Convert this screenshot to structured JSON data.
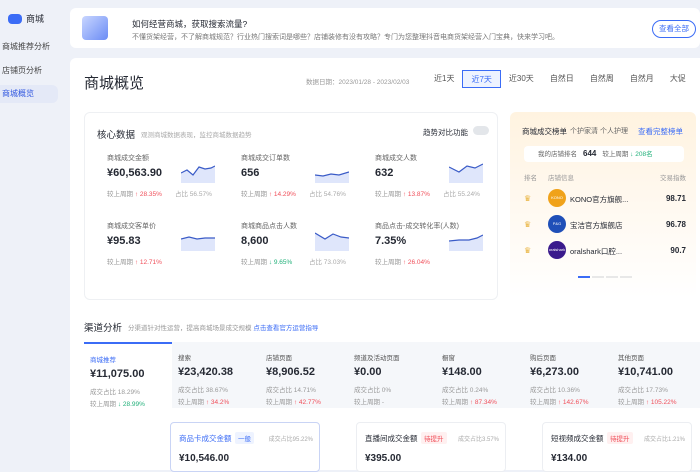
{
  "sidebar": {
    "brand": "商城",
    "items": [
      "商城推荐分析",
      "店铺页分析",
      "商城概览"
    ]
  },
  "banner": {
    "title": "如何经营商城，获取搜索流量?",
    "desc": "不懂货架经营，不了解商城规范？行业热门搜索词是哪些？店铺装修有没有攻略？专门为您整理抖音电商货架经营入门宝典，快来学习吧。",
    "button": "查看全部"
  },
  "header": {
    "title": "商城概览",
    "date": "数据日期：2023/01/28 - 2023/02/03",
    "ranges": [
      "近1天",
      "近7天",
      "近30天",
      "自然日",
      "自然周",
      "自然月",
      "大促"
    ]
  },
  "core": {
    "title": "核心数据",
    "subtitle": "观测商城数据表现，监控商城数据趋势",
    "trend_toggle": "趋势对比功能",
    "metrics": [
      {
        "label": "商城成交金额",
        "value": "¥60,563.90",
        "cmp_label": "较上周期",
        "change": "↑ 28.35%",
        "dir": "up",
        "share": "占比 56.57%"
      },
      {
        "label": "商城成交订单数",
        "value": "656",
        "cmp_label": "较上周期",
        "change": "↑ 14.29%",
        "dir": "up",
        "share": "占比 54.76%"
      },
      {
        "label": "商城成交人数",
        "value": "632",
        "cmp_label": "较上周期",
        "change": "↑ 13.87%",
        "dir": "up",
        "share": "占比 55.24%"
      },
      {
        "label": "商城成交客单价",
        "value": "¥95.83",
        "cmp_label": "较上周期",
        "change": "↑ 12.71%",
        "dir": "up",
        "share": ""
      },
      {
        "label": "商城商品点击人数",
        "value": "8,600",
        "cmp_label": "较上周期",
        "change": "↓ 9.65%",
        "dir": "down",
        "share": "占比 73.03%"
      },
      {
        "label": "商品点击-成交转化率(人数)",
        "value": "7.35%",
        "cmp_label": "较上周期",
        "change": "↑ 26.04%",
        "dir": "up",
        "share": ""
      }
    ]
  },
  "ranking": {
    "title": "商城成交榜单",
    "category": "个护家清 个人护理",
    "link": "查看完整榜单",
    "my_rank_label": "我的店铺排名",
    "my_rank": "644",
    "my_rank_cmp": "较上周期",
    "my_rank_change": "↓ 208名",
    "headers": [
      "排名",
      "店铺信息",
      "交易指数"
    ],
    "rows": [
      {
        "name": "KONO官方旗舰...",
        "score": "98.71",
        "logo": "KONO",
        "color": "#f0a21a"
      },
      {
        "name": "宝洁官方旗舰店",
        "score": "96.78",
        "logo": "P&G",
        "color": "#1f4fb8"
      },
      {
        "name": "oralshark口腔...",
        "score": "90.7",
        "logo": "oralshark",
        "color": "#3a1a8c"
      }
    ]
  },
  "channel": {
    "title": "渠道分析",
    "subtitle": "分渠道针对性运营，提高商城场景成交规模",
    "link": "点击查看官方运营指导",
    "tabs": [
      {
        "name": "商城推荐",
        "value": "¥11,075.00",
        "share": "成交占比 18.29%",
        "cmp": "较上周期",
        "change": "↓ 28.99%",
        "dir": "down"
      },
      {
        "name": "搜索",
        "value": "¥23,420.38",
        "share": "成交占比 38.67%",
        "cmp": "较上周期",
        "change": "↑ 34.2%",
        "dir": "up"
      },
      {
        "name": "店铺页面",
        "value": "¥8,906.52",
        "share": "成交占比 14.71%",
        "cmp": "较上周期",
        "change": "↑ 42.77%",
        "dir": "up"
      },
      {
        "name": "频道及活动页面",
        "value": "¥0.00",
        "share": "成交占比 0%",
        "cmp": "较上周期",
        "change": "-",
        "dir": ""
      },
      {
        "name": "橱窗",
        "value": "¥148.00",
        "share": "成交占比 0.24%",
        "cmp": "较上周期",
        "change": "↑ 87.34%",
        "dir": "up"
      },
      {
        "name": "购后页面",
        "value": "¥6,273.00",
        "share": "成交占比 10.36%",
        "cmp": "较上周期",
        "change": "↑ 142.67%",
        "dir": "up"
      },
      {
        "name": "其他页面",
        "value": "¥10,741.00",
        "share": "成交占比 17.73%",
        "cmp": "较上周期",
        "change": "↑ 105.22%",
        "dir": "up"
      }
    ],
    "sub": [
      {
        "name": "商品卡成交金额",
        "badge": "一般",
        "share": "成交占比95.22%",
        "value": "¥10,546.00"
      },
      {
        "name": "直播间成交金额",
        "badge": "待提升",
        "share": "成交占比3.57%",
        "value": "¥395.00"
      },
      {
        "name": "短视频成交金额",
        "badge": "待提升",
        "share": "成交占比1.21%",
        "value": "¥134.00"
      }
    ]
  },
  "colors": {
    "accent": "#3b6cf6",
    "up": "#f04f5a",
    "down": "#22b07a"
  }
}
